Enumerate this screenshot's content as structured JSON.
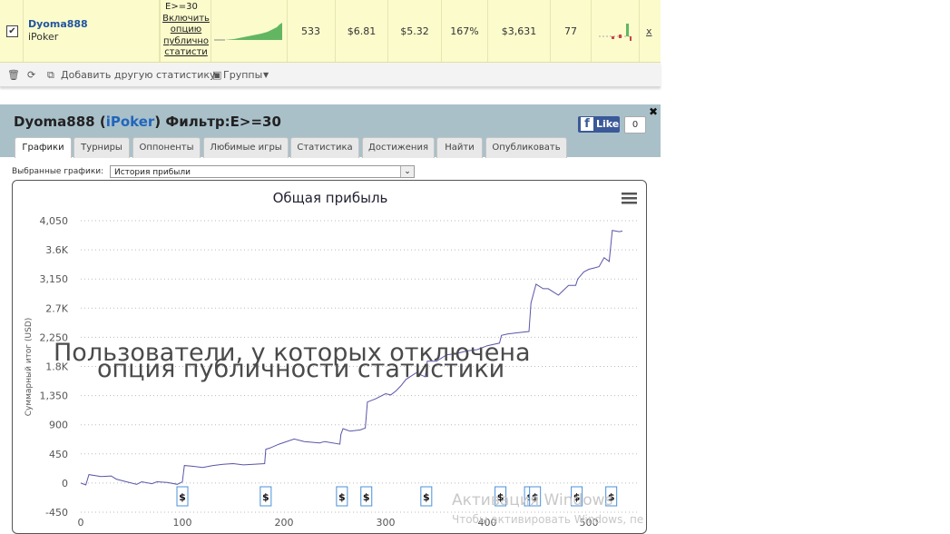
{
  "row": {
    "player": "Dyoma888",
    "site": "iPoker",
    "filter": "E>=30",
    "public_link_lines": [
      "Включить",
      "опцию",
      "публично",
      "статисти"
    ],
    "stats": [
      "533",
      "$6.81",
      "$5.32",
      "167%",
      "$3,631",
      "77"
    ],
    "close": "x"
  },
  "toolbar": {
    "add_stat": "Добавить другую статистику",
    "groups": "Группы"
  },
  "header": {
    "player": "Dyoma888",
    "site": "iPoker",
    "filter_label": "Фильтр:E>=30",
    "like_label": "Like",
    "like_count": "0",
    "close": "✖"
  },
  "tabs": [
    "Графики",
    "Турниры",
    "Оппоненты",
    "Любимые игры",
    "Статистика",
    "Достижения",
    "Найти",
    "Опубликовать"
  ],
  "graphs": {
    "selected_label": "Выбранные графики:",
    "selected_value": "История прибыли"
  },
  "overlay": {
    "line1": "Пользователи, у которых отключена",
    "line2": "опция публичности статистики"
  },
  "watermark": {
    "line1": "Активация Windows",
    "line2": "Чтобы активировать Windows, пе"
  },
  "chart_data": {
    "type": "line",
    "title": "Общая прибыль",
    "ylabel": "Суммарный итог (USD)",
    "xlabel": "",
    "ylim": [
      -450,
      4050
    ],
    "xlim": [
      0,
      533
    ],
    "x_ticks": [
      0,
      100,
      200,
      300,
      400,
      500
    ],
    "y_ticks": [
      "-450",
      "0",
      "450",
      "900",
      "1,350",
      "1.8K",
      "2,250",
      "2.7K",
      "3,150",
      "3.6K",
      "4,050"
    ],
    "y_tick_values": [
      -450,
      0,
      450,
      900,
      1350,
      1800,
      2250,
      2700,
      3150,
      3600,
      4050
    ],
    "cashout_markers_x": [
      100,
      182,
      257,
      281,
      340,
      413,
      442,
      447,
      488,
      522
    ],
    "marker_label": "$",
    "series": [
      {
        "values_x": [
          0,
          5,
          8,
          20,
          30,
          35,
          45,
          55,
          60,
          70,
          75,
          85,
          95,
          99,
          100,
          102,
          110,
          120,
          130,
          140,
          150,
          160,
          170,
          181,
          182,
          186,
          195,
          210,
          220,
          235,
          240,
          255,
          256,
          258,
          265,
          275,
          280,
          282,
          290,
          300,
          305,
          310,
          315,
          320,
          330,
          339,
          341,
          350,
          360,
          370,
          380,
          390,
          400,
          412,
          414,
          420,
          430,
          441,
          443,
          448,
          455,
          460,
          470,
          480,
          487,
          489,
          495,
          500,
          505,
          510,
          515,
          520,
          523,
          530,
          533
        ],
        "values_y": [
          0,
          -30,
          130,
          100,
          110,
          60,
          20,
          -20,
          20,
          -10,
          20,
          10,
          -20,
          10,
          20,
          270,
          260,
          240,
          270,
          290,
          300,
          280,
          290,
          300,
          520,
          540,
          600,
          680,
          640,
          620,
          640,
          600,
          750,
          840,
          800,
          820,
          850,
          1250,
          1300,
          1380,
          1360,
          1420,
          1500,
          1600,
          1700,
          1640,
          1880,
          1880,
          1980,
          2000,
          2040,
          2060,
          2120,
          2160,
          2280,
          2300,
          2320,
          2340,
          2780,
          3070,
          3000,
          3000,
          2900,
          3050,
          3050,
          3150,
          3260,
          3300,
          3320,
          3340,
          3480,
          3420,
          3900,
          3880,
          3890
        ]
      }
    ]
  }
}
